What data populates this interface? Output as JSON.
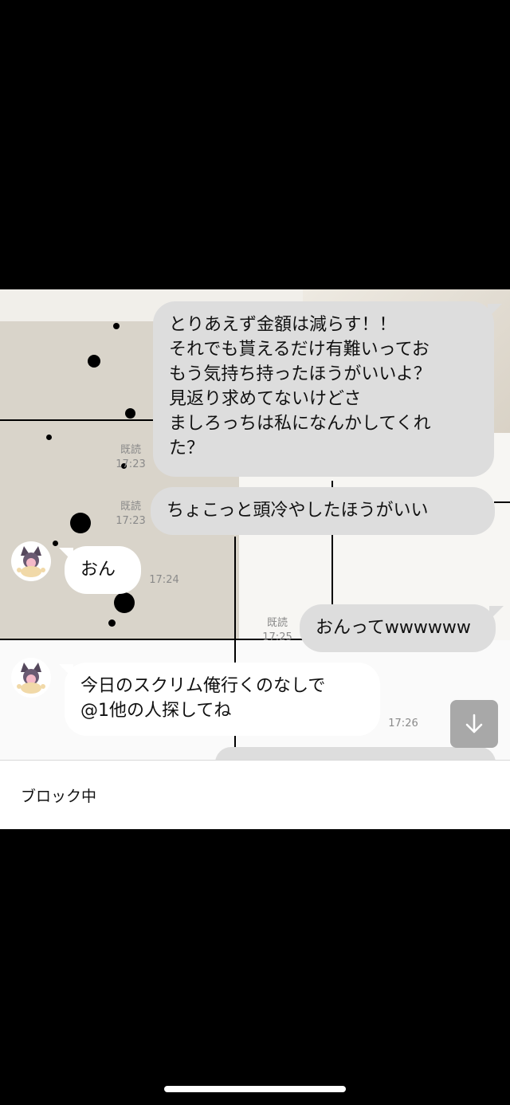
{
  "messages": [
    {
      "side": "out",
      "text": "とりあえず金額は減らす！！\nそれでも貰えるだけ有難いってお\nもう気持ち持ったほうがいいよ？\n見返り求めてないけどさ\nましろっちは私になんかしてくれ\nた？",
      "read": "既読",
      "time": "17:23"
    },
    {
      "side": "out",
      "text": "ちょこっと頭冷やしたほうがいい",
      "read": "既読",
      "time": "17:23"
    },
    {
      "side": "in",
      "text": "おん",
      "time": "17:24"
    },
    {
      "side": "out",
      "text": "おんってwwwwww",
      "read": "既読",
      "time": "17:25"
    },
    {
      "side": "in",
      "text": "今日のスクリム俺行くのなしで\n@1他の人探してね",
      "time": "17:26"
    }
  ],
  "footer": {
    "label": "ブロック中"
  },
  "icons": {
    "scroll_down": "arrow-down-icon",
    "avatar": "character-avatar"
  },
  "colors": {
    "outgoing_bubble": "#dddddd",
    "incoming_bubble": "#ffffff",
    "meta_text": "#8a8a8a",
    "scroll_button": "#a8a8a8"
  }
}
